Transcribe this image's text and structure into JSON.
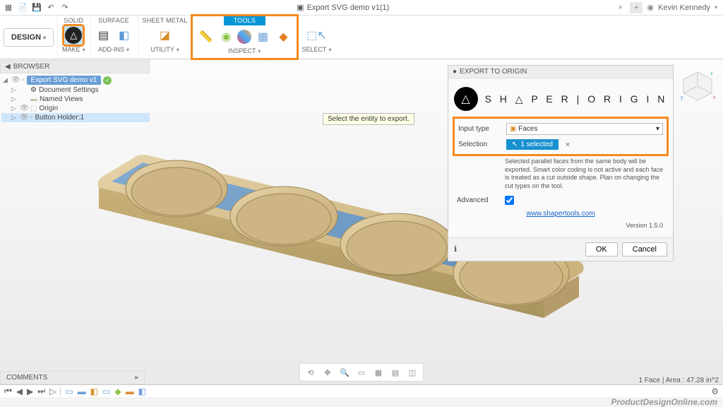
{
  "titlebar": {
    "doc_title": "Export SVG demo v1(1)",
    "user": "Kevin Kennedy"
  },
  "ribbon": {
    "design": "DESIGN",
    "groups": {
      "solid": "SOLID",
      "surface": "SURFACE",
      "sheetmetal": "SHEET METAL",
      "tools": "TOOLS"
    },
    "labels": {
      "make": "MAKE",
      "addins": "ADD-INS",
      "utility": "UTILITY",
      "inspect": "INSPECT",
      "select": "SELECT"
    }
  },
  "browser": {
    "title": "BROWSER",
    "root": "Export SVG demo v1",
    "items": [
      "Document Settings",
      "Named Views",
      "Origin",
      "Button Holder:1"
    ]
  },
  "tooltip": "Select the entity to export.",
  "panel": {
    "title": "EXPORT TO ORIGIN",
    "logo": "S H △ P E R | O R I G I N",
    "input_type_label": "Input type",
    "input_type_value": "Faces",
    "selection_label": "Selection",
    "selection_value": "1 selected",
    "description": "Selected parallel faces from the same body will be exported. Smart color coding is not active and each face is treated as a cut outside shape. Plan on changing the cut types on the tool.",
    "advanced_label": "Advanced",
    "link": "www.shapertools.com",
    "version": "Version 1.5.0",
    "ok": "OK",
    "cancel": "Cancel"
  },
  "comments": "COMMENTS",
  "status": "1 Face | Area : 47.28 in^2",
  "watermark": "ProductDesignOnline.com"
}
